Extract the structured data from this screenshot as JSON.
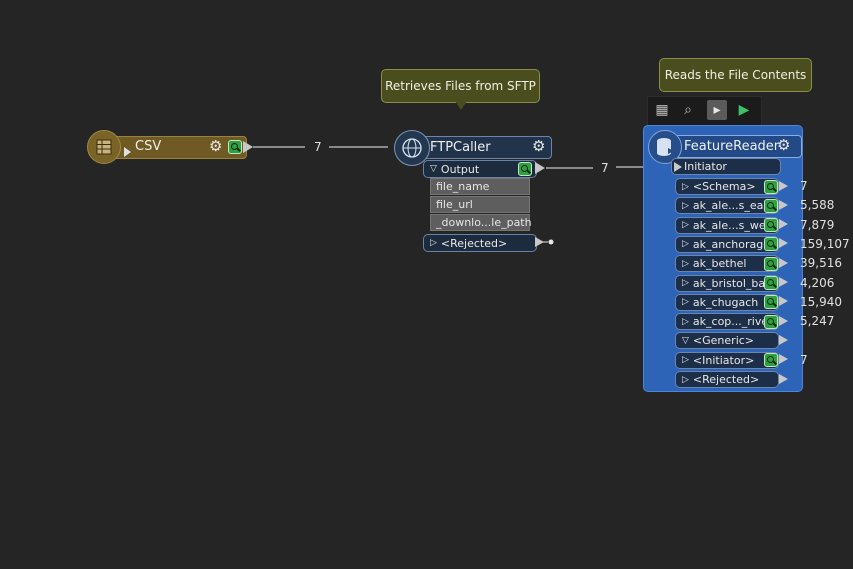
{
  "annotations": [
    {
      "text": "Retrieves Files from SFTP"
    },
    {
      "text": "Reads the File Contents"
    }
  ],
  "csv": {
    "title": "CSV",
    "icon": "table-icon"
  },
  "ftp": {
    "title": "FTPCaller",
    "icon": "network-globe-icon",
    "output_port": "Output",
    "attributes": [
      "file_name",
      "file_url",
      "_downlo...le_path"
    ],
    "rejected_port": "<Rejected>"
  },
  "feature_reader": {
    "title": "FeatureReader",
    "icon": "database-icon",
    "input_port": "Initiator",
    "ports": [
      {
        "label": "<Schema>",
        "count": "7"
      },
      {
        "label": "ak_ale...s_east",
        "count": "5,588"
      },
      {
        "label": "ak_ale...s_west",
        "count": "7,879"
      },
      {
        "label": "ak_anchorage",
        "count": "159,107"
      },
      {
        "label": "ak_bethel",
        "count": "39,516"
      },
      {
        "label": "ak_bristol_bay",
        "count": "4,206"
      },
      {
        "label": "ak_chugach",
        "count": "15,940"
      },
      {
        "label": "ak_cop..._river",
        "count": "5,247"
      },
      {
        "label": "<Generic>",
        "count": ""
      },
      {
        "label": "<Initiator>",
        "count": "7"
      },
      {
        "label": "<Rejected>",
        "count": ""
      }
    ]
  },
  "connections": [
    {
      "from": "CSV",
      "to": "FTPCaller",
      "count": "7"
    },
    {
      "from": "FTPCaller.Output",
      "to": "FeatureReader.Initiator",
      "count": "7"
    }
  ],
  "toolbar_icons": [
    "workspace-icon",
    "search-feature-icon",
    "run-to-this-icon",
    "run-from-this-icon"
  ],
  "colors": {
    "canvas": "#252525",
    "csv": "#6e5a22",
    "ftp": "#22344c",
    "feature_reader": "#2e64b8",
    "annotation": "#4a4e1f"
  }
}
